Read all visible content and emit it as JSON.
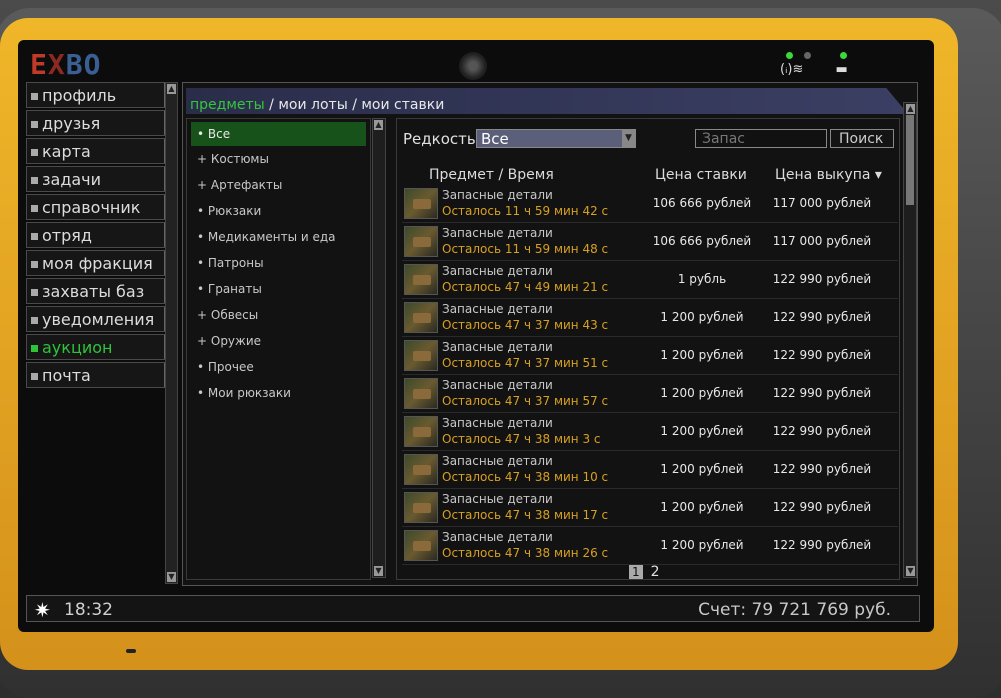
{
  "logo": {
    "e": "E",
    "x": "X",
    "bo": "BO"
  },
  "status": {
    "wifi_icon": "wifi-icon",
    "battery_icon": "battery-icon"
  },
  "menu": [
    {
      "label": "профиль",
      "active": false
    },
    {
      "label": "друзья",
      "active": false
    },
    {
      "label": "карта",
      "active": false
    },
    {
      "label": "задачи",
      "active": false
    },
    {
      "label": "справочник",
      "active": false
    },
    {
      "label": "отряд",
      "active": false
    },
    {
      "label": "моя фракция",
      "active": false
    },
    {
      "label": "захваты баз",
      "active": false
    },
    {
      "label": "уведомления",
      "active": false
    },
    {
      "label": "аукцион",
      "active": true
    },
    {
      "label": "почта",
      "active": false
    }
  ],
  "breadcrumb": {
    "active": "предметы",
    "sep1": "/",
    "lots": "мои лоты",
    "sep2": "/",
    "bids": "мои ставки"
  },
  "categories": [
    "• Все",
    "+ Костюмы",
    "+ Артефакты",
    "• Рюкзаки",
    "• Медикаменты и еда",
    "• Патроны",
    "• Гранаты",
    "+ Обвесы",
    "+ Оружие",
    "• Прочее",
    "• Мои рюкзаки"
  ],
  "filter": {
    "rarity_label": "Редкость",
    "rarity_value": "Все",
    "search_placeholder": "Запас",
    "search_button": "Поиск"
  },
  "table": {
    "headers": {
      "item_time": "Предмет   /   Время",
      "bid": "Цена ставки",
      "buyout": "Цена выкупа ▾"
    },
    "rows": [
      {
        "name": "Запасные детали",
        "time": "Осталось 11 ч 59 мин 42 с",
        "bid": "106 666 рублей",
        "buyout": "117 000 рублей"
      },
      {
        "name": "Запасные детали",
        "time": "Осталось 11 ч 59 мин 48 с",
        "bid": "106 666 рублей",
        "buyout": "117 000 рублей"
      },
      {
        "name": "Запасные детали",
        "time": "Осталось 47 ч 49 мин 21 с",
        "bid": "1 рубль",
        "buyout": "122 990 рублей"
      },
      {
        "name": "Запасные детали",
        "time": "Осталось 47 ч 37 мин 43 с",
        "bid": "1 200 рублей",
        "buyout": "122 990 рублей"
      },
      {
        "name": "Запасные детали",
        "time": "Осталось 47 ч 37 мин 51 с",
        "bid": "1 200 рублей",
        "buyout": "122 990 рублей"
      },
      {
        "name": "Запасные детали",
        "time": "Осталось 47 ч 37 мин 57 с",
        "bid": "1 200 рублей",
        "buyout": "122 990 рублей"
      },
      {
        "name": "Запасные детали",
        "time": "Осталось 47 ч 38 мин 3 с",
        "bid": "1 200 рублей",
        "buyout": "122 990 рублей"
      },
      {
        "name": "Запасные детали",
        "time": "Осталось 47 ч 38 мин 10 с",
        "bid": "1 200 рублей",
        "buyout": "122 990 рублей"
      },
      {
        "name": "Запасные детали",
        "time": "Осталось 47 ч 38 мин 17 с",
        "bid": "1 200 рублей",
        "buyout": "122 990 рублей"
      },
      {
        "name": "Запасные детали",
        "time": "Осталось 47 ч 38 мин 26 с",
        "bid": "1 200 рублей",
        "buyout": "122 990 рублей"
      }
    ]
  },
  "pager": {
    "current": "1",
    "next": "2"
  },
  "footer": {
    "time": "18:32",
    "balance": "Счет: 79 721 769 руб."
  },
  "colors": {
    "accent_green": "#2ec43a",
    "timer_orange": "#d8a020",
    "device_yellow": "#f0b629"
  }
}
